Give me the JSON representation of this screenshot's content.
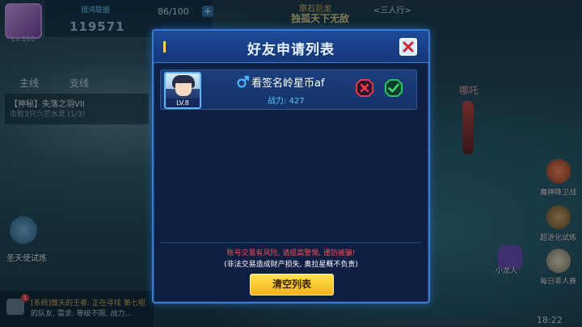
{
  "hud": {
    "level": "Lv.100",
    "guild": "猎鸿联盟",
    "combat_power": "119571",
    "stamina": "86/100",
    "plus": "+",
    "boss_name": "原石巨龙",
    "title_banner": "独孤天下无敌",
    "team": "<三人行>"
  },
  "quests": {
    "tab_main": "主线",
    "tab_side": "支线",
    "title": "【神秘】失落之羽VII",
    "desc": "击败3只六芒水灵 (1/3)"
  },
  "trial": {
    "label": "圣天使试炼"
  },
  "npc": {
    "name": "哪吒"
  },
  "side_icons": {
    "fox": "小龙人",
    "demon": "魔神降卫战",
    "evolve": "超进化试炼",
    "daily": "每日菲人赛"
  },
  "chat": {
    "badge": "1",
    "line1": "[系统]傲天的王者: 正在寻找 第七祖",
    "line2": "的队友, 需求: 等级不限, 战力..."
  },
  "clock": "18:22",
  "modal": {
    "title": "好友申请列表",
    "requests": [
      {
        "level": "LV.8",
        "name": "看签名岭星币af",
        "power": "战力: 427"
      }
    ],
    "warning": "账号交易有风险, 请提高警惕, 谨防被骗!",
    "disclaimer": "(非法交易造成财产损失, 奥拉星概不负责)",
    "clear_button": "清空列表"
  },
  "colors": {
    "modal_bg": "#0f1f44",
    "modal_border": "#3b7bd0",
    "accent_yellow": "#f5b11b",
    "warning_red": "#ff4a4a",
    "power_blue": "#56c8ff",
    "accept_green": "#22c55e",
    "reject_red": "#e23a4a"
  }
}
